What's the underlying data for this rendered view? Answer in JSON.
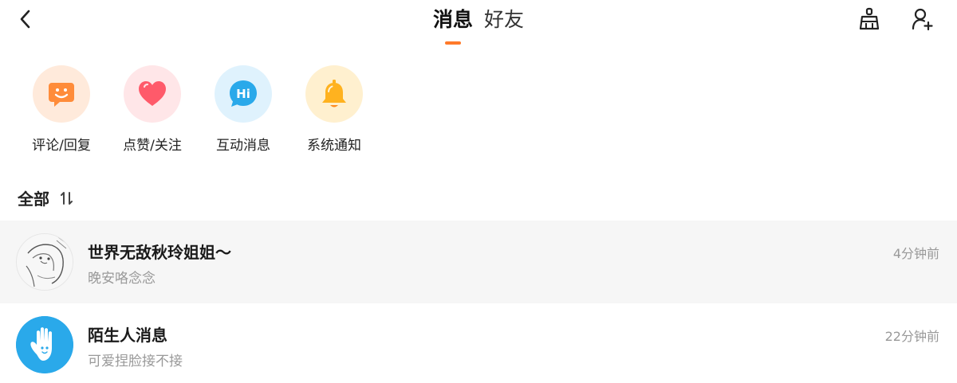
{
  "header": {
    "tabs": [
      {
        "label": "消息",
        "active": true
      },
      {
        "label": "好友",
        "active": false
      }
    ]
  },
  "categories": [
    {
      "label": "评论/回复",
      "icon": "comment-icon",
      "bg": "#ffeadb",
      "color": "#ff8c3a"
    },
    {
      "label": "点赞/关注",
      "icon": "heart-icon",
      "bg": "#ffe6e8",
      "color": "#ff5a6a"
    },
    {
      "label": "互动消息",
      "icon": "hi-icon",
      "bg": "#dff2fd",
      "color": "#2aa9ea"
    },
    {
      "label": "系统通知",
      "icon": "bell-icon",
      "bg": "#fff0cf",
      "color": "#ffb21f"
    }
  ],
  "list_header": {
    "title": "全部",
    "sort_icon": "sort-icon"
  },
  "messages": [
    {
      "name": "世界无敌秋玲姐姐～",
      "preview": "晚安咯念念",
      "time": "4分钟前",
      "avatar": "sketch-avatar"
    },
    {
      "name": "陌生人消息",
      "preview": "可爱捏脸接不接",
      "time": "22分钟前",
      "avatar": "hand-avatar",
      "avatar_color": "#2aa9ea"
    }
  ],
  "colors": {
    "accent": "#ff7a2a",
    "highlight_row": "#f6f6f6",
    "muted_text": "#999999"
  }
}
